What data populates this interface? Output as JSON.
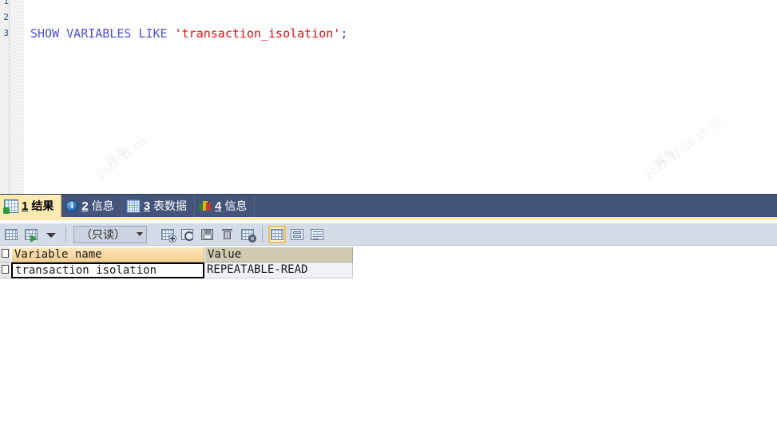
{
  "editor": {
    "line_numbers": [
      "1",
      "2",
      "3"
    ],
    "sql_lines": [
      {
        "tokens": []
      },
      {
        "tokens": []
      },
      {
        "tokens": [
          {
            "t": "SHOW VARIABLES LIKE ",
            "c": "kw"
          },
          {
            "t": "'transaction_isolation'",
            "c": "str"
          },
          {
            "t": ";",
            "c": "pn"
          }
        ]
      }
    ],
    "full_statement": "SHOW VARIABLES LIKE 'transaction_isolation';"
  },
  "watermarks": [
    {
      "text": "智海\n2023-11-06 15:52"
    },
    {
      "text": "智海 2023-11-06 15:52"
    }
  ],
  "tabstrip": {
    "tabs": [
      {
        "number": "1",
        "label": "结果",
        "icon": "result-grid-icon",
        "active": true
      },
      {
        "number": "2",
        "label": "信息",
        "icon": "info-circle-icon",
        "active": false
      },
      {
        "number": "3",
        "label": "表数据",
        "icon": "table-data-icon",
        "active": false
      },
      {
        "number": "4",
        "label": "信息",
        "icon": "chart-info-icon",
        "active": false
      }
    ]
  },
  "toolbar": {
    "buttons": [
      {
        "name": "grid-view-icon",
        "title": "网格"
      },
      {
        "name": "export-grid-icon",
        "title": "导出"
      },
      {
        "name": "chevron-down-icon",
        "title": "更多"
      }
    ],
    "readonly_select": {
      "value": "（只读）",
      "options": [
        "（只读）"
      ]
    },
    "record_buttons": [
      {
        "name": "add-record-icon",
        "title": "添加记录"
      },
      {
        "name": "refresh-icon",
        "title": "刷新"
      },
      {
        "name": "save-record-icon",
        "title": "应用改变"
      },
      {
        "name": "delete-record-icon",
        "title": "删除记录"
      },
      {
        "name": "cancel-edit-icon",
        "title": "放弃改变"
      }
    ],
    "view_buttons": [
      {
        "name": "view-grid-icon",
        "title": "网格查看",
        "active": true
      },
      {
        "name": "view-form-icon",
        "title": "表单查看",
        "active": false
      },
      {
        "name": "view-text-icon",
        "title": "备注查看",
        "active": false
      }
    ]
  },
  "result_grid": {
    "columns": [
      {
        "label": "Variable name",
        "active": true
      },
      {
        "label": "Value",
        "active": false
      }
    ],
    "rows": [
      {
        "cells": [
          {
            "value": "transaction isolation",
            "selected": true
          },
          {
            "value": "REPEATABLE-READ",
            "selected": false
          }
        ]
      }
    ]
  },
  "colors": {
    "tabstrip_bg": "#44557c",
    "active_tab_bg": "#fdeab0",
    "toolbar_bg": "#d4dce8",
    "header_active": "#f6cf8e",
    "header_idle": "#cfcab0",
    "cell_bg": "#f0f2f8",
    "keyword": "#5050d0",
    "string": "#e01010"
  }
}
